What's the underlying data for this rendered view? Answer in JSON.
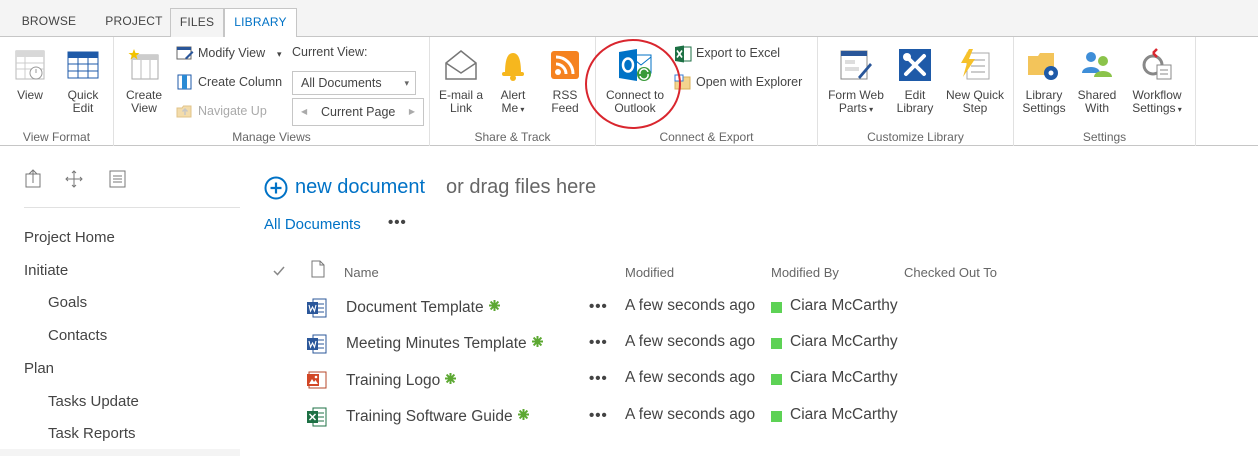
{
  "tabs": [
    {
      "label": "BROWSE"
    },
    {
      "label": "PROJECT"
    },
    {
      "label": "FILES"
    },
    {
      "label": "LIBRARY"
    }
  ],
  "ribbon": {
    "view_format": {
      "group_label": "View Format",
      "view": "View",
      "quick_edit_1": "Quick",
      "quick_edit_2": "Edit"
    },
    "manage_views": {
      "group_label": "Manage Views",
      "create_view_1": "Create",
      "create_view_2": "View",
      "modify_view": "Modify View",
      "create_column": "Create Column",
      "navigate_up": "Navigate Up",
      "current_view_label": "Current View:",
      "current_view_value": "All Documents",
      "current_page": "Current Page"
    },
    "share_track": {
      "group_label": "Share & Track",
      "email_1": "E-mail a",
      "email_2": "Link",
      "alert_1": "Alert",
      "alert_2": "Me",
      "rss_1": "RSS",
      "rss_2": "Feed"
    },
    "connect_export": {
      "group_label": "Connect & Export",
      "outlook_1": "Connect to",
      "outlook_2": "Outlook",
      "export_excel": "Export to Excel",
      "open_explorer": "Open with Explorer"
    },
    "customize": {
      "group_label": "Customize Library",
      "form_web_1": "Form Web",
      "form_web_2": "Parts",
      "edit_lib_1": "Edit",
      "edit_lib_2": "Library",
      "quick_step_1": "New Quick",
      "quick_step_2": "Step"
    },
    "settings": {
      "group_label": "Settings",
      "lib_settings_1": "Library",
      "lib_settings_2": "Settings",
      "shared_1": "Shared",
      "shared_2": "With",
      "workflow_1": "Workflow",
      "workflow_2": "Settings"
    }
  },
  "nav": {
    "items": [
      {
        "label": "Project Home"
      },
      {
        "label": "Initiate"
      },
      {
        "label": "Goals"
      },
      {
        "label": "Contacts"
      },
      {
        "label": "Plan"
      },
      {
        "label": "Tasks Update"
      },
      {
        "label": "Task Reports"
      }
    ]
  },
  "main": {
    "new_doc_link": "new document",
    "new_doc_rest": "or drag files here",
    "view_name": "All Documents",
    "ellipsis": "•••",
    "columns": {
      "name": "Name",
      "modified": "Modified",
      "modified_by": "Modified By",
      "checked_out": "Checked Out To"
    },
    "rows": [
      {
        "name": "Document Template",
        "type": "word",
        "modified": "A few seconds ago",
        "modified_by": "Ciara McCarthy"
      },
      {
        "name": "Meeting Minutes Template",
        "type": "word",
        "modified": "A few seconds ago",
        "modified_by": "Ciara McCarthy"
      },
      {
        "name": "Training Logo",
        "type": "image",
        "modified": "A few seconds ago",
        "modified_by": "Ciara McCarthy"
      },
      {
        "name": "Training Software Guide",
        "type": "excel",
        "modified": "A few seconds ago",
        "modified_by": "Ciara McCarthy"
      }
    ]
  },
  "colors": {
    "accent": "#0072c6",
    "presence": "#5dd255",
    "new_badge": "#5ca832",
    "annotation": "#d9262e"
  }
}
